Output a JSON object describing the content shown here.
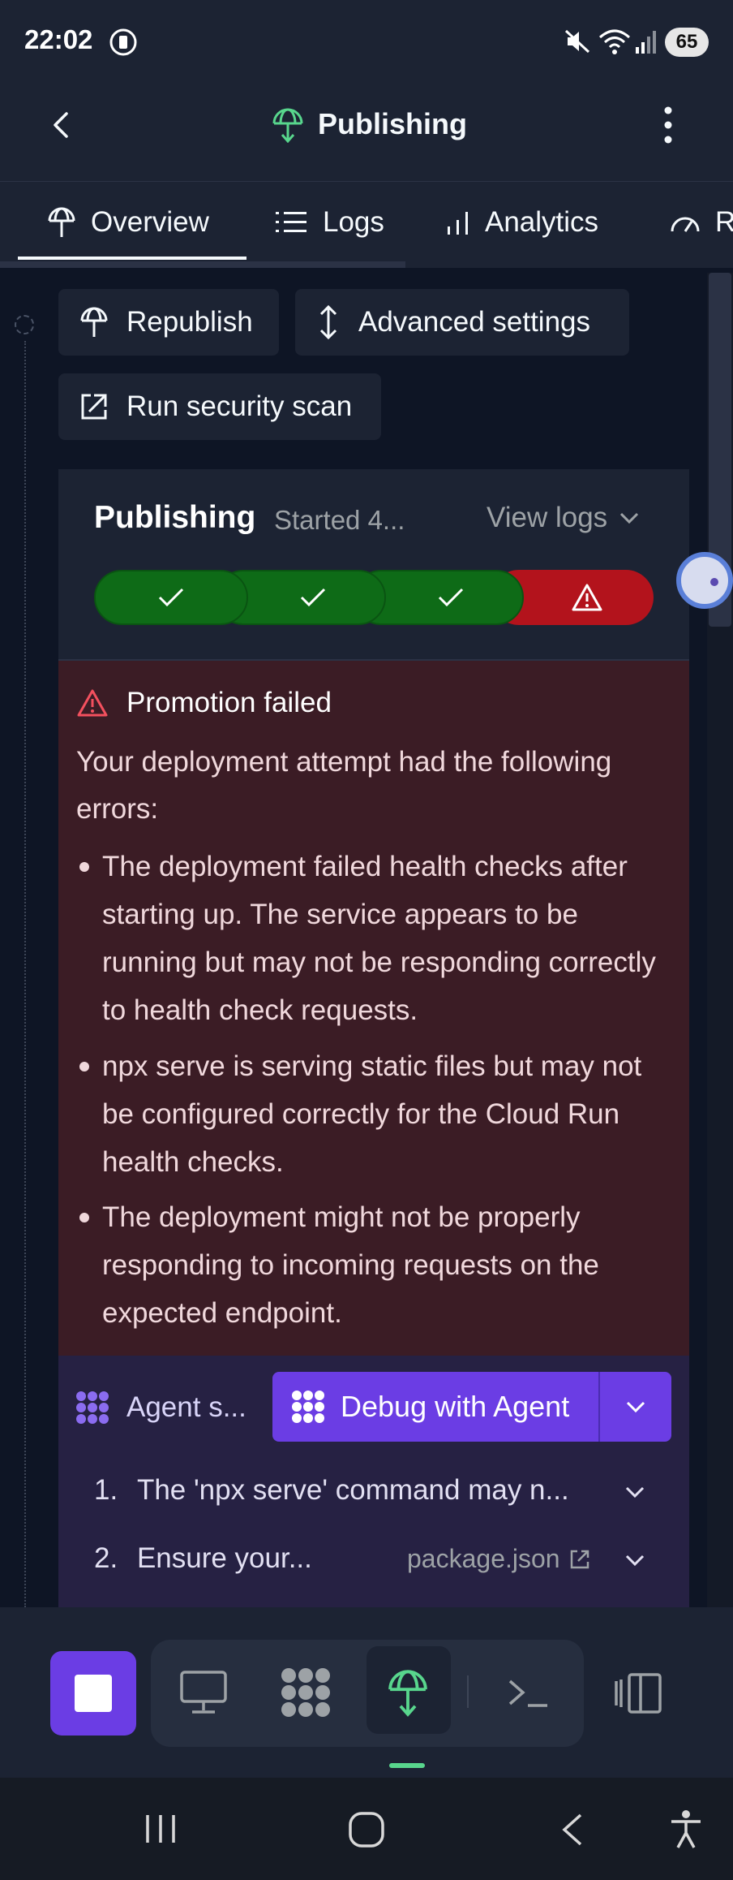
{
  "status_bar": {
    "time": "22:02",
    "battery": "65"
  },
  "header": {
    "title": "Publishing"
  },
  "tabs": [
    {
      "label": "Overview",
      "active": true
    },
    {
      "label": "Logs"
    },
    {
      "label": "Analytics"
    },
    {
      "label": "R"
    }
  ],
  "actions": {
    "republish": "Republish",
    "advanced_settings": "Advanced settings",
    "security_scan": "Run security scan"
  },
  "publishing_card": {
    "title": "Publishing",
    "subtitle": "Started 4...",
    "view_logs": "View logs",
    "steps": [
      {
        "status": "success"
      },
      {
        "status": "success"
      },
      {
        "status": "success"
      },
      {
        "status": "failed"
      }
    ],
    "colors": {
      "success": "#0e6b17",
      "failed": "#b3131c"
    }
  },
  "error": {
    "title": "Promotion failed",
    "intro": "Your deployment attempt had the following errors:",
    "items": [
      "The deployment failed health checks after starting up. The service appears to be running but may not be responding correctly to health check requests.",
      "npx serve is serving static files but may not be configured correctly for the Cloud Run health checks.",
      "The deployment might not be properly responding to incoming requests on the expected endpoint."
    ]
  },
  "agent": {
    "label": "Agent s...",
    "debug_button": "Debug with Agent",
    "suggestions": [
      {
        "num": "1.",
        "text": "The 'npx serve' command may n..."
      },
      {
        "num": "2.",
        "text": "Ensure your...",
        "link": "package.json"
      }
    ]
  },
  "bottom_toolbar": {
    "tools": [
      "stop-icon",
      "desktop-icon",
      "agent-icon",
      "deploy-icon",
      "terminal-icon",
      "layout-icon"
    ]
  }
}
